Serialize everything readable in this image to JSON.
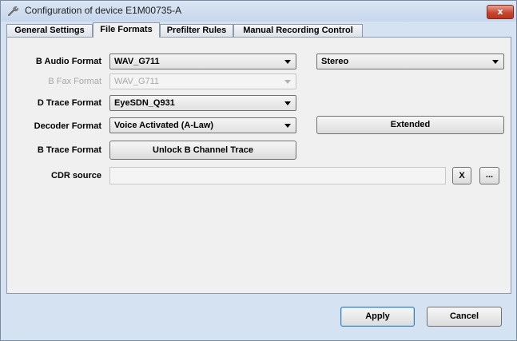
{
  "window": {
    "title": "Configuration of device E1M00735-A",
    "close_label": "x"
  },
  "tabs": [
    {
      "label": "General Settings",
      "active": false
    },
    {
      "label": "File Formats",
      "active": true
    },
    {
      "label": "Prefilter Rules",
      "active": false
    },
    {
      "label": "Manual Recording Control",
      "active": false
    }
  ],
  "form": {
    "b_audio": {
      "label": "B Audio Format",
      "value": "WAV_G711",
      "channel_value": "Stereo"
    },
    "b_fax": {
      "label": "B Fax Format",
      "value": "WAV_G711",
      "disabled": true
    },
    "d_trace": {
      "label": "D Trace Format",
      "value": "EyeSDN_Q931"
    },
    "decoder": {
      "label": "Decoder Format",
      "value": "Voice Activated (A-Law)",
      "extended_label": "Extended"
    },
    "b_trace": {
      "label": "B Trace Format",
      "button_label": "Unlock B Channel Trace"
    },
    "cdr": {
      "label": "CDR source",
      "value": "",
      "clear_label": "X",
      "browse_label": "..."
    }
  },
  "footer": {
    "apply_label": "Apply",
    "cancel_label": "Cancel"
  },
  "colors": {
    "close_button": "#c8462f",
    "default_button_border": "#3c7fb1"
  },
  "icons": {
    "title": "wrench-icon",
    "dropdown": "chevron-down-icon"
  }
}
